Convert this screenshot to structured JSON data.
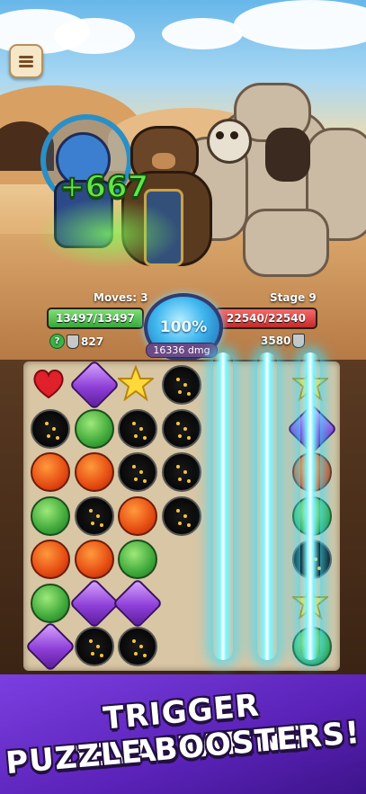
{
  "hud": {
    "heal_amount": "+667",
    "moves_label": "Moves: 3",
    "stage_label": "Stage 9",
    "player_hp": "13497/13497",
    "enemy_hp": "22540/22540",
    "power_percent": "100%",
    "damage": "16336 dmg",
    "help_label": "?",
    "player_defense": "827",
    "enemy_defense": "3580"
  },
  "board": {
    "rows": [
      [
        "heart",
        "amethyst",
        "star",
        "dark",
        "blank",
        "blank",
        "star"
      ],
      [
        "dark",
        "leaf",
        "dark",
        "dark",
        "blank",
        "blank",
        "amethyst"
      ],
      [
        "fire",
        "fire",
        "dark",
        "dark",
        "blank",
        "blank",
        "fire"
      ],
      [
        "leaf",
        "dark",
        "fire",
        "dark",
        "blank",
        "blank",
        "leaf"
      ],
      [
        "fire",
        "fire",
        "leaf",
        "blank",
        "blank",
        "blank",
        "dark"
      ],
      [
        "leaf",
        "amethyst",
        "amethyst",
        "blank",
        "blank",
        "blank",
        "star"
      ],
      [
        "amethyst",
        "dark",
        "dark",
        "blank",
        "blank",
        "blank",
        "leaf"
      ]
    ],
    "beam_columns": [
      4,
      5,
      6
    ]
  },
  "banner": {
    "line1": "TRIGGER DEVASTATING",
    "line2": "PUZZLE BOOSTERS!"
  }
}
